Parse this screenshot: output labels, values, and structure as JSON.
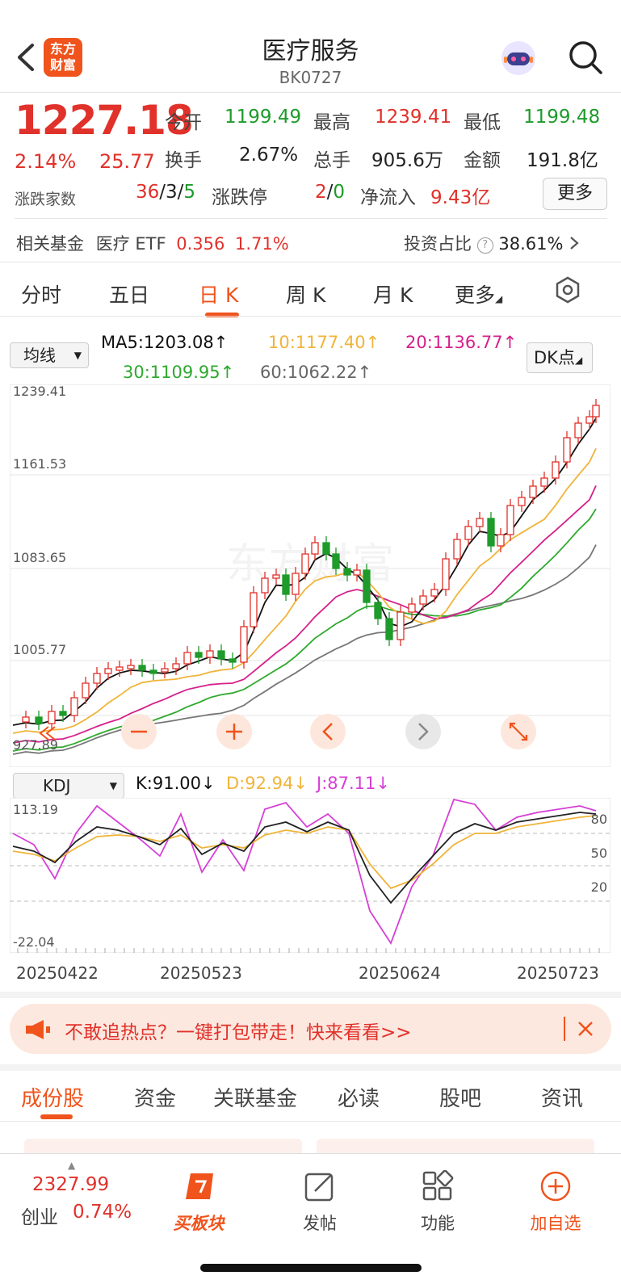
{
  "header": {
    "title": "医疗服务",
    "code": "BK0727",
    "logo_text": "东方财富"
  },
  "quote": {
    "price": "1227.18",
    "change_pct": "2.14%",
    "change": "25.77",
    "open_label": "今开",
    "open": "1199.49",
    "high_label": "最高",
    "high": "1239.41",
    "low_label": "最低",
    "low": "1199.48",
    "turnover_label": "换手",
    "turnover": "2.67%",
    "volume_label": "总手",
    "volume": "905.6万",
    "amount_label": "金额",
    "amount": "191.8亿",
    "updown_label": "涨跌家数",
    "up_count": "36",
    "flat_count": "3",
    "down_count": "5",
    "limit_label": "涨跌停",
    "limit_up": "2",
    "limit_down": "0",
    "netflow_label": "净流入",
    "netflow": "9.43亿",
    "more_label": "更多"
  },
  "fund": {
    "label": "相关基金",
    "name": "医疗 ETF",
    "price": "0.356",
    "pct": "1.71%",
    "ratio_label": "投资占比",
    "ratio": "38.61%"
  },
  "kline_tabs": [
    {
      "label": "分时"
    },
    {
      "label": "五日"
    },
    {
      "label": "日 K"
    },
    {
      "label": "周 K"
    },
    {
      "label": "月 K"
    },
    {
      "label": "更多"
    }
  ],
  "ma": {
    "select": "均线",
    "ma5": "MA5:1203.08↑",
    "ma10": "10:1177.40↑",
    "ma20": "20:1136.77↑",
    "ma30": "30:1109.95↑",
    "ma60": "60:1062.22↑",
    "dk_label": "DK点"
  },
  "kline_axis": {
    "top": "1239.41",
    "l2": "1161.53",
    "l3": "1083.65",
    "l4": "1005.77",
    "bottom": "927.89"
  },
  "kdj": {
    "select": "KDJ",
    "k": "K:91.00↓",
    "d": "D:92.94↓",
    "j": "J:87.11↓",
    "axis_top": "113.19",
    "axis_bottom": "-22.04",
    "lvl80": "80",
    "lvl50": "50",
    "lvl20": "20"
  },
  "dates": [
    "20250422",
    "20250523",
    "20250624",
    "20250723"
  ],
  "banner": {
    "text": "不敢追热点？一键打包带走！快来看看>>"
  },
  "bottom_tabs": [
    {
      "label": "成份股"
    },
    {
      "label": "资金"
    },
    {
      "label": "关联基金"
    },
    {
      "label": "必读"
    },
    {
      "label": "股吧"
    },
    {
      "label": "资讯"
    }
  ],
  "bottom_bar": {
    "index_value": "2327.99",
    "index_name": "创业",
    "index_pct": "0.74%",
    "buy_label": "买板块",
    "post_label": "发帖",
    "func_label": "功能",
    "add_label": "加自选"
  },
  "colors": {
    "up": "#e0312a",
    "down": "#1e9b2a",
    "accent": "#f0531c",
    "ma5": "#111111",
    "ma10": "#f0b43a",
    "ma20": "#d6208c",
    "ma30": "#2ea92e",
    "ma60": "#777777"
  }
}
